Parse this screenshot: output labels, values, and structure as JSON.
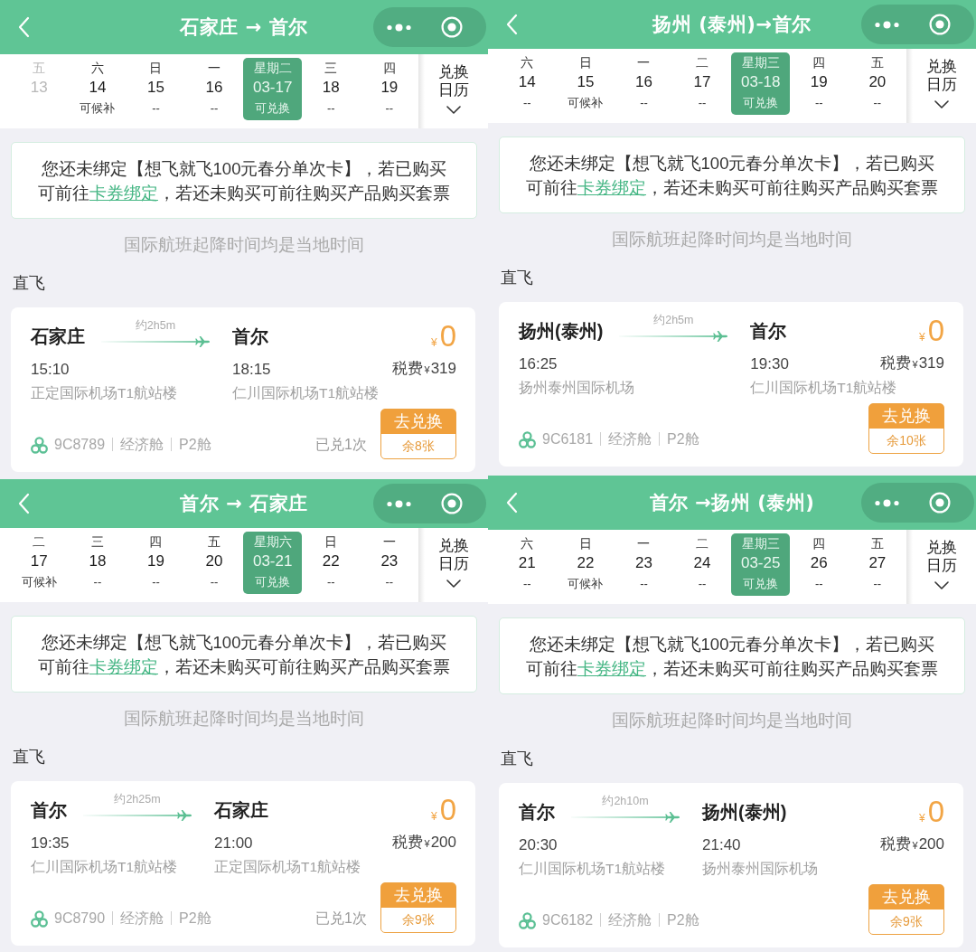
{
  "panels": [
    {
      "title_bar": {
        "title": "石家庄 → 首尔"
      },
      "calendar": {
        "days": [
          {
            "weekday": "五",
            "date": "13",
            "selected": false,
            "disabled": true
          },
          {
            "weekday": "六",
            "date": "14",
            "status": "可候补",
            "selected": false,
            "disabled": false
          },
          {
            "weekday": "日",
            "date": "15",
            "status": "--",
            "selected": false,
            "disabled": false
          },
          {
            "weekday": "一",
            "date": "16",
            "status": "--",
            "selected": false,
            "disabled": false
          },
          {
            "weekday": "星期二",
            "date": "03-17",
            "status": "可兑换",
            "selected": true,
            "disabled": false
          },
          {
            "weekday": "三",
            "date": "18",
            "status": "--",
            "selected": false,
            "disabled": false
          },
          {
            "weekday": "四",
            "date": "19",
            "status": "--",
            "selected": false,
            "disabled": false
          }
        ],
        "calendar_button": "兑换日历"
      },
      "notice": {
        "text_before": "您还未绑定【想飞就飞100元春分单次卡】，若已购买可前往",
        "link": "卡券绑定",
        "text_after": "，若还未购买可前往购买产品购买套票"
      },
      "timezone_note": "国际航班起降时间均是当地时间",
      "section_label": "直飞",
      "flight": {
        "from_city": "石家庄",
        "duration": "约2h5m",
        "to_city": "首尔",
        "price": {
          "currency": "¥",
          "amount": "0"
        },
        "depart_time": "15:10",
        "arrive_time": "18:15",
        "tax": {
          "label": "税费",
          "currency": "¥",
          "amount": "319"
        },
        "depart_airport": "正定国际机场T1航站楼",
        "arrive_airport": "仁川国际机场T1航站楼",
        "flight_number": "9C8789",
        "cabin": "经济舱",
        "fare_class": "P2舱",
        "redeemed": "已兑1次",
        "action": "去兑换",
        "remaining": "余8张"
      }
    },
    {
      "title_bar": {
        "title": "扬州 (泰州)→首尔"
      },
      "calendar": {
        "days": [
          {
            "weekday": "六",
            "date": "14",
            "status": "--",
            "selected": false,
            "disabled": false
          },
          {
            "weekday": "日",
            "date": "15",
            "status": "可候补",
            "selected": false,
            "disabled": false
          },
          {
            "weekday": "一",
            "date": "16",
            "status": "--",
            "selected": false,
            "disabled": false
          },
          {
            "weekday": "二",
            "date": "17",
            "status": "--",
            "selected": false,
            "disabled": false
          },
          {
            "weekday": "星期三",
            "date": "03-18",
            "status": "可兑换",
            "selected": true,
            "disabled": false
          },
          {
            "weekday": "四",
            "date": "19",
            "status": "--",
            "selected": false,
            "disabled": false
          },
          {
            "weekday": "五",
            "date": "20",
            "status": "--",
            "selected": false,
            "disabled": false
          }
        ],
        "calendar_button": "兑换日历"
      },
      "notice": {
        "text_before": "您还未绑定【想飞就飞100元春分单次卡】，若已购买可前往",
        "link": "卡券绑定",
        "text_after": "，若还未购买可前往购买产品购买套票"
      },
      "timezone_note": "国际航班起降时间均是当地时间",
      "section_label": "直飞",
      "flight": {
        "from_city": "扬州(泰州)",
        "duration": "约2h5m",
        "to_city": "首尔",
        "price": {
          "currency": "¥",
          "amount": "0"
        },
        "depart_time": "16:25",
        "arrive_time": "19:30",
        "tax": {
          "label": "税费",
          "currency": "¥",
          "amount": "319"
        },
        "depart_airport": "扬州泰州国际机场",
        "arrive_airport": "仁川国际机场T1航站楼",
        "flight_number": "9C6181",
        "cabin": "经济舱",
        "fare_class": "P2舱",
        "action": "去兑换",
        "remaining": "余10张"
      }
    },
    {
      "title_bar": {
        "title": "首尔 → 石家庄"
      },
      "calendar": {
        "days": [
          {
            "weekday": "二",
            "date": "17",
            "status": "可候补",
            "selected": false,
            "disabled": false
          },
          {
            "weekday": "三",
            "date": "18",
            "status": "--",
            "selected": false,
            "disabled": false
          },
          {
            "weekday": "四",
            "date": "19",
            "status": "--",
            "selected": false,
            "disabled": false
          },
          {
            "weekday": "五",
            "date": "20",
            "status": "--",
            "selected": false,
            "disabled": false
          },
          {
            "weekday": "星期六",
            "date": "03-21",
            "status": "可兑换",
            "selected": true,
            "disabled": false
          },
          {
            "weekday": "日",
            "date": "22",
            "status": "--",
            "selected": false,
            "disabled": false
          },
          {
            "weekday": "一",
            "date": "23",
            "status": "--",
            "selected": false,
            "disabled": false
          }
        ],
        "calendar_button": "兑换日历"
      },
      "notice": {
        "text_before": "您还未绑定【想飞就飞100元春分单次卡】，若已购买可前往",
        "link": "卡券绑定",
        "text_after": "，若还未购买可前往购买产品购买套票"
      },
      "timezone_note": "国际航班起降时间均是当地时间",
      "section_label": "直飞",
      "flight": {
        "from_city": "首尔",
        "duration": "约2h25m",
        "to_city": "石家庄",
        "price": {
          "currency": "¥",
          "amount": "0"
        },
        "depart_time": "19:35",
        "arrive_time": "21:00",
        "tax": {
          "label": "税费",
          "currency": "¥",
          "amount": "200"
        },
        "depart_airport": "仁川国际机场T1航站楼",
        "arrive_airport": "正定国际机场T1航站楼",
        "flight_number": "9C8790",
        "cabin": "经济舱",
        "fare_class": "P2舱",
        "redeemed": "已兑1次",
        "action": "去兑换",
        "remaining": "余9张"
      }
    },
    {
      "title_bar": {
        "title": "首尔 →扬州 (泰州)"
      },
      "calendar": {
        "days": [
          {
            "weekday": "六",
            "date": "21",
            "status": "--",
            "selected": false,
            "disabled": false
          },
          {
            "weekday": "日",
            "date": "22",
            "status": "可候补",
            "selected": false,
            "disabled": false
          },
          {
            "weekday": "一",
            "date": "23",
            "status": "--",
            "selected": false,
            "disabled": false
          },
          {
            "weekday": "二",
            "date": "24",
            "status": "--",
            "selected": false,
            "disabled": false
          },
          {
            "weekday": "星期三",
            "date": "03-25",
            "status": "可兑换",
            "selected": true,
            "disabled": false
          },
          {
            "weekday": "四",
            "date": "26",
            "status": "--",
            "selected": false,
            "disabled": false
          },
          {
            "weekday": "五",
            "date": "27",
            "status": "--",
            "selected": false,
            "disabled": false
          }
        ],
        "calendar_button": "兑换日历"
      },
      "notice": {
        "text_before": "您还未绑定【想飞就飞100元春分单次卡】，若已购买可前往",
        "link": "卡券绑定",
        "text_after": "，若还未购买可前往购买产品购买套票"
      },
      "timezone_note": "国际航班起降时间均是当地时间",
      "section_label": "直飞",
      "flight": {
        "from_city": "首尔",
        "duration": "约2h10m",
        "to_city": "扬州(泰州)",
        "price": {
          "currency": "¥",
          "amount": "0"
        },
        "depart_time": "20:30",
        "arrive_time": "21:40",
        "tax": {
          "label": "税费",
          "currency": "¥",
          "amount": "200"
        },
        "depart_airport": "仁川国际机场T1航站楼",
        "arrive_airport": "扬州泰州国际机场",
        "flight_number": "9C6182",
        "cabin": "经济舱",
        "fare_class": "P2舱",
        "action": "去兑换",
        "remaining": "余9张"
      }
    }
  ]
}
